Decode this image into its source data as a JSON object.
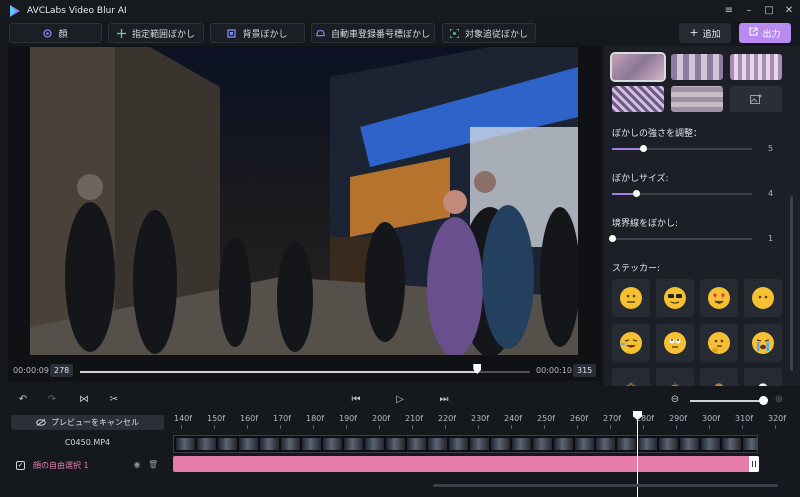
{
  "app": {
    "title": "AVCLabs Video Blur AI"
  },
  "window_controls": [
    "menu-icon",
    "minimize-icon",
    "maximize-icon",
    "close-icon"
  ],
  "toolbar": {
    "items": [
      {
        "label": "顔",
        "icon": "face-icon"
      },
      {
        "label": "指定範囲ぼかし",
        "icon": "crosshair-icon"
      },
      {
        "label": "背景ぼかし",
        "icon": "background-icon"
      },
      {
        "label": "自動車登録番号標ぼかし",
        "icon": "car-icon"
      },
      {
        "label": "対象追従ぼかし",
        "icon": "target-icon"
      }
    ],
    "add_label": "追加",
    "export_label": "出力",
    "accent": "#b98af2"
  },
  "preview": {
    "current_time": "00:00:09",
    "current_frame": "278",
    "end_time": "00:00:10",
    "end_frame": "315",
    "progress": 0.883
  },
  "panel": {
    "blur_styles": [
      "blur-style-1",
      "blur-style-2",
      "blur-style-3",
      "blur-style-4",
      "blur-style-5",
      "add-image-icon"
    ],
    "selected_style": 0,
    "strength": {
      "label": "ぼかしの強さを調整：",
      "value": "5",
      "fraction": 0.22
    },
    "size": {
      "label": "ぼかしサイズ:",
      "value": "4",
      "fraction": 0.17
    },
    "edge": {
      "label": "境界線をぼかし:",
      "value": "1",
      "fraction": 0.0
    },
    "sticker_label": "ステッカー:",
    "stickers": [
      "neutral-face",
      "sunglasses-face",
      "heart-eyes-face",
      "blank-face",
      "laughing-face",
      "eye-roll-face",
      "thinking-face",
      "crying-face",
      "sticker-9",
      "sticker-10",
      "sticker-11",
      "sticker-12"
    ]
  },
  "timeline": {
    "cancel_preview_label": "プレビューをキャンセル",
    "file_name": "C0450.MP4",
    "blur_item_label": "顔の自由選択 1",
    "ruler": [
      "140f",
      "150f",
      "160f",
      "170f",
      "180f",
      "190f",
      "200f",
      "210f",
      "220f",
      "230f",
      "240f",
      "250f",
      "260f",
      "270f",
      "280f",
      "290f",
      "300f",
      "310f",
      "320f"
    ]
  }
}
